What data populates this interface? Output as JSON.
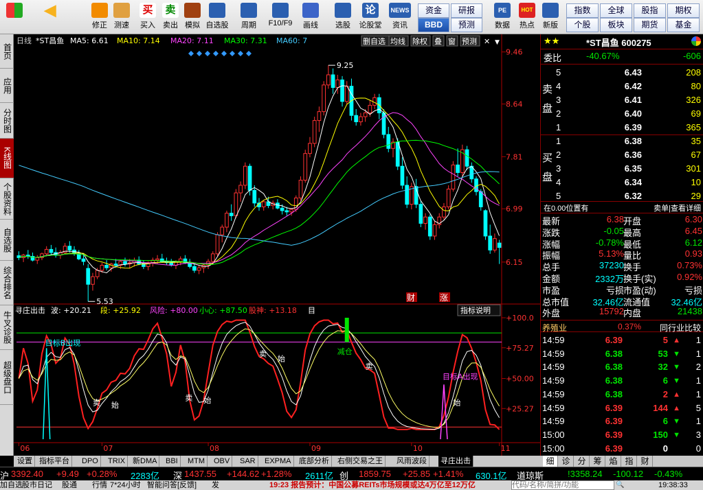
{
  "toolbar": {
    "buttons": [
      {
        "label": "",
        "icon": "grid-icon"
      },
      {
        "label": "",
        "icon": "back-arrow-icon"
      },
      {
        "label": "修正",
        "icon": "pinwheel-icon"
      },
      {
        "label": "测速",
        "icon": "clock-icon"
      },
      {
        "label": "买入",
        "icon": "buy-icon"
      },
      {
        "label": "卖出",
        "icon": "sell-icon"
      },
      {
        "label": "模拟",
        "icon": "hammer-icon"
      },
      {
        "label": "自选股",
        "icon": "star-folder-icon"
      },
      {
        "label": "周期",
        "icon": "cycle-icon"
      },
      {
        "label": "F10/F9",
        "icon": "f10-icon"
      },
      {
        "label": "画线",
        "icon": "pen-icon"
      },
      {
        "label": "选股",
        "icon": "select-stock-icon"
      },
      {
        "label": "论股堂",
        "icon": "forum-icon"
      },
      {
        "label": "资讯",
        "icon": "news-icon"
      },
      {
        "label": "数据",
        "icon": "data-icon"
      },
      {
        "label": "热点",
        "icon": "hot-icon"
      },
      {
        "label": "新版",
        "icon": "new-version-icon"
      }
    ],
    "forum_glyph": "论",
    "news_glyph": "NEWS",
    "pe_glyph": "PE",
    "hot_glyph": "HOT",
    "buy_glyph": "买",
    "sell_glyph": "卖",
    "top_links": [
      "资金",
      "研报",
      "BBD",
      "预测"
    ],
    "index_links": [
      "指数",
      "全球",
      "股指",
      "期权",
      "个股",
      "板块",
      "期货",
      "基金"
    ]
  },
  "leftnav": [
    "首页",
    "应用",
    "分时图",
    "K线图",
    "个股资料",
    "自选股",
    "综合排名",
    "牛叉诊股",
    "超级盘口"
  ],
  "chart": {
    "legend": {
      "period": "日线",
      "name": "*ST昌鱼",
      "ma5": "MA5: 6.61",
      "ma10": "MA10: 7.14",
      "ma20": "MA20: 7.11",
      "ma30": "MA30: 7.31",
      "ma60": "MA60: 7"
    },
    "tools": [
      "删自选",
      "均线",
      "除权",
      "叠",
      "窗",
      "预测"
    ],
    "price_labels": [
      "9.46",
      "8.64",
      "7.81",
      "6.99",
      "6.15"
    ],
    "high_label": "9.25",
    "low_label": "5.53",
    "marker_cai": "财",
    "marker_zhang": "涨",
    "month_labels": [
      "06",
      "07",
      "08",
      "09",
      "10",
      "11"
    ],
    "indicator": {
      "name": "寻庄出击",
      "bo": "波: +20.21",
      "duan": "段: +25.92",
      "risk": "风险: +80.00",
      "care": "小心: +87.50",
      "god": "股神: +13.18",
      "tail": "目",
      "help": "指标说明",
      "levels": [
        "+100.0",
        "+75.27",
        "+50.00",
        "+25.27"
      ],
      "target_b": "目标B出现",
      "target_a": "目标A出现",
      "reduce": "减仓",
      "signals": [
        "卖",
        "始",
        "卖",
        "始",
        "卖",
        "始",
        "卖",
        "始"
      ]
    }
  },
  "chart_data": {
    "type": "candlestick",
    "title": "*ST昌鱼",
    "x_labels": [
      "06",
      "07",
      "08",
      "09",
      "10",
      "11"
    ],
    "ylim": [
      5.5,
      9.5
    ],
    "price_ticks": [
      9.46,
      8.64,
      7.81,
      6.99,
      6.15
    ],
    "indicator_ticks": [
      100.0,
      75.27,
      50.0,
      25.27
    ],
    "candles": [
      [
        6.25,
        6.32,
        6.18,
        6.22
      ],
      [
        6.22,
        6.28,
        6.15,
        6.26
      ],
      [
        6.26,
        6.34,
        6.2,
        6.24
      ],
      [
        6.24,
        6.3,
        6.16,
        6.18
      ],
      [
        6.18,
        6.26,
        6.12,
        6.22
      ],
      [
        6.22,
        6.3,
        6.18,
        6.28
      ],
      [
        6.28,
        6.4,
        6.24,
        6.35
      ],
      [
        6.35,
        6.42,
        6.26,
        6.3
      ],
      [
        6.3,
        6.38,
        6.22,
        6.26
      ],
      [
        6.26,
        6.34,
        6.2,
        6.3
      ],
      [
        6.3,
        6.45,
        6.28,
        6.4
      ],
      [
        6.4,
        6.48,
        6.3,
        6.34
      ],
      [
        6.34,
        6.4,
        6.25,
        6.28
      ],
      [
        6.28,
        6.34,
        6.18,
        6.2
      ],
      [
        6.2,
        6.26,
        6.1,
        6.16
      ],
      [
        6.05,
        6.12,
        5.53,
        5.8
      ],
      [
        5.8,
        5.98,
        5.7,
        5.92
      ],
      [
        5.92,
        6.06,
        5.88,
        6.02
      ],
      [
        6.02,
        6.14,
        5.98,
        6.1
      ],
      [
        6.1,
        6.18,
        6.02,
        6.06
      ],
      [
        6.06,
        6.14,
        6.0,
        6.12
      ],
      [
        6.12,
        6.2,
        6.06,
        6.1
      ],
      [
        6.1,
        6.18,
        6.04,
        6.16
      ],
      [
        6.16,
        6.22,
        6.08,
        6.12
      ],
      [
        6.12,
        6.2,
        6.05,
        6.14
      ],
      [
        6.14,
        6.22,
        6.08,
        6.18
      ],
      [
        6.18,
        6.24,
        6.1,
        6.12
      ],
      [
        6.12,
        6.18,
        6.04,
        6.08
      ],
      [
        6.08,
        6.16,
        6.02,
        6.14
      ],
      [
        6.14,
        6.22,
        6.08,
        6.18
      ],
      [
        6.18,
        6.26,
        6.12,
        6.2
      ],
      [
        6.2,
        6.28,
        6.14,
        6.16
      ],
      [
        6.16,
        6.22,
        6.1,
        6.14
      ],
      [
        6.14,
        6.2,
        6.08,
        6.1
      ],
      [
        6.1,
        6.18,
        6.04,
        6.16
      ],
      [
        6.16,
        6.24,
        6.1,
        6.2
      ],
      [
        6.2,
        6.26,
        6.12,
        6.14
      ],
      [
        6.14,
        6.2,
        6.05,
        6.08
      ],
      [
        6.08,
        6.14,
        5.98,
        6.02
      ],
      [
        6.02,
        6.1,
        5.96,
        6.06
      ],
      [
        6.06,
        6.12,
        5.98,
        6.1
      ],
      [
        6.1,
        6.2,
        6.04,
        6.16
      ],
      [
        6.16,
        6.32,
        6.12,
        6.28
      ],
      [
        6.28,
        6.62,
        6.24,
        6.58
      ],
      [
        6.58,
        6.74,
        6.46,
        6.7
      ],
      [
        6.7,
        6.96,
        6.62,
        6.92
      ],
      [
        6.92,
        7.06,
        6.8,
        6.88
      ],
      [
        6.88,
        7.3,
        6.84,
        7.24
      ],
      [
        7.24,
        7.42,
        7.1,
        7.36
      ],
      [
        7.36,
        7.72,
        7.3,
        7.66
      ],
      [
        7.66,
        7.7,
        7.2,
        7.28
      ],
      [
        7.28,
        7.36,
        7.02,
        7.08
      ],
      [
        7.08,
        7.16,
        6.96,
        7.02
      ],
      [
        7.02,
        7.12,
        6.96,
        7.1
      ],
      [
        7.1,
        7.18,
        7.0,
        7.04
      ],
      [
        7.04,
        7.12,
        6.98,
        7.08
      ],
      [
        7.08,
        7.14,
        6.98,
        7.0
      ],
      [
        7.0,
        7.06,
        6.9,
        6.96
      ],
      [
        6.96,
        7.02,
        6.88,
        6.94
      ],
      [
        6.94,
        7.0,
        6.88,
        6.98
      ],
      [
        6.98,
        7.2,
        6.94,
        7.16
      ],
      [
        7.16,
        7.5,
        7.12,
        7.44
      ],
      [
        7.44,
        7.92,
        7.4,
        7.86
      ],
      [
        7.86,
        8.12,
        7.8,
        8.02
      ],
      [
        8.02,
        8.44,
        7.96,
        8.38
      ],
      [
        8.38,
        8.6,
        8.2,
        8.52
      ],
      [
        8.52,
        9.0,
        8.46,
        8.94
      ],
      [
        8.94,
        9.25,
        8.88,
        9.1
      ],
      [
        9.1,
        9.2,
        8.8,
        8.9
      ],
      [
        8.9,
        9.1,
        8.8,
        9.02
      ],
      [
        9.02,
        9.08,
        8.6,
        8.68
      ],
      [
        8.68,
        9.0,
        8.64,
        8.92
      ],
      [
        8.92,
        9.04,
        8.38,
        8.46
      ],
      [
        8.46,
        8.56,
        8.3,
        8.36
      ],
      [
        8.36,
        8.5,
        8.3,
        8.44
      ],
      [
        8.44,
        8.56,
        8.36,
        8.5
      ],
      [
        8.5,
        8.7,
        8.44,
        8.62
      ],
      [
        8.62,
        8.8,
        8.56,
        8.74
      ],
      [
        8.74,
        8.8,
        8.4,
        8.5
      ],
      [
        8.5,
        8.56,
        8.1,
        8.16
      ],
      [
        8.16,
        8.28,
        7.88,
        7.94
      ],
      [
        7.94,
        8.1,
        7.8,
        8.04
      ],
      [
        8.04,
        8.1,
        7.6,
        7.66
      ],
      [
        7.66,
        7.8,
        7.3,
        7.36
      ],
      [
        7.36,
        7.5,
        7.0,
        7.06
      ],
      [
        7.06,
        7.4,
        6.98,
        7.34
      ],
      [
        7.34,
        7.46,
        7.0,
        7.06
      ],
      [
        7.06,
        7.12,
        6.7,
        6.76
      ],
      [
        6.76,
        6.92,
        6.66,
        6.86
      ],
      [
        6.86,
        6.9,
        6.5,
        6.56
      ],
      [
        6.56,
        6.8,
        6.5,
        6.74
      ],
      [
        6.74,
        6.92,
        6.68,
        6.86
      ],
      [
        6.86,
        7.08,
        6.82,
        7.02
      ],
      [
        7.02,
        7.36,
        6.98,
        7.3
      ],
      [
        7.3,
        7.74,
        7.26,
        7.68
      ],
      [
        7.68,
        7.94,
        7.5,
        7.56
      ],
      [
        7.56,
        8.0,
        7.5,
        7.92
      ],
      [
        7.92,
        7.98,
        7.6,
        7.66
      ],
      [
        7.66,
        7.72,
        7.4,
        7.46
      ],
      [
        7.46,
        7.5,
        7.2,
        7.26
      ],
      [
        7.26,
        7.3,
        6.96,
        7.02
      ],
      [
        6.96,
        6.98,
        6.5,
        6.56
      ],
      [
        6.56,
        6.74,
        6.28,
        6.34
      ],
      [
        6.34,
        6.6,
        6.3,
        6.52
      ],
      [
        6.45,
        6.5,
        6.12,
        6.38
      ]
    ]
  },
  "panel": {
    "stars": "★★",
    "title": "*ST昌鱼 600275",
    "wei_label": "委比",
    "wei_pct": "-40.67%",
    "wei_diff": "-606",
    "sell_side": "卖盘",
    "buy_side": "买盘",
    "asks": [
      [
        "5",
        "6.43",
        "208"
      ],
      [
        "4",
        "6.42",
        "80"
      ],
      [
        "3",
        "6.41",
        "326"
      ],
      [
        "2",
        "6.40",
        "69"
      ],
      [
        "1",
        "6.39",
        "365"
      ]
    ],
    "bids": [
      [
        "1",
        "6.38",
        "35"
      ],
      [
        "2",
        "6.36",
        "67"
      ],
      [
        "3",
        "6.35",
        "301"
      ],
      [
        "4",
        "6.34",
        "10"
      ],
      [
        "5",
        "6.32",
        "29"
      ]
    ],
    "pos": "在0.00位置有",
    "pos_right": "卖单|查看详细",
    "stats": [
      [
        "最新",
        "6.38",
        "开盘",
        "6.30"
      ],
      [
        "涨跌",
        "-0.05",
        "最高",
        "6.45"
      ],
      [
        "涨幅",
        "-0.78%",
        "最低",
        "6.12"
      ],
      [
        "振幅",
        "5.13%",
        "量比",
        "0.93"
      ],
      [
        "总手",
        "37230",
        "换手",
        "0.73%"
      ],
      [
        "金额",
        "2332万",
        "换手(实)",
        "0.92%"
      ],
      [
        "市盈",
        "亏损",
        "市盈(动)",
        "亏损"
      ],
      [
        "总市值",
        "32.46亿",
        "流通值",
        "32.46亿"
      ],
      [
        "外盘",
        "15792",
        "内盘",
        "21438"
      ]
    ],
    "industry": "养殖业",
    "industry_pct": "0.37%",
    "industry_cmp": "同行业比较",
    "ticks": [
      [
        "14:59",
        "6.39",
        "5",
        "up",
        "1"
      ],
      [
        "14:59",
        "6.38",
        "53",
        "down",
        "1"
      ],
      [
        "14:59",
        "6.38",
        "32",
        "down",
        "2"
      ],
      [
        "14:59",
        "6.38",
        "6",
        "down",
        "1"
      ],
      [
        "14:59",
        "6.38",
        "2",
        "up",
        "1"
      ],
      [
        "14:59",
        "6.39",
        "144",
        "up",
        "5"
      ],
      [
        "14:59",
        "6.39",
        "6",
        "down",
        "1"
      ],
      [
        "15:00",
        "6.39",
        "150",
        "down",
        "3"
      ],
      [
        "15:00",
        "6.39",
        "0",
        "",
        "0"
      ]
    ],
    "tabs": [
      "细",
      "诊",
      "分",
      "筹",
      "焰",
      "指",
      "财"
    ]
  },
  "bottom_tabs": [
    "设置",
    "指标平台",
    "DPO",
    "TRIX",
    "新DMA",
    "BBI",
    "MTM",
    "OBV",
    "SAR",
    "EXPMA",
    "底部分析",
    "右侧交易之王",
    "风雨波段",
    "寻庄出击"
  ],
  "index_bar": {
    "sh_label": "沪",
    "sh_val": "3392.40",
    "sh_chg": "+9.49",
    "sh_pct": "+0.28%",
    "sh_amt": "2283亿",
    "sz_label": "深",
    "sz_val": "1437.55",
    "sz_chg": "+144.62",
    "sz_pct": "+1.28%",
    "sz_amt": "2611亿",
    "cy_label": "创",
    "cy_val": "1859.75",
    "cy_chg": "+25.85",
    "cy_pct": "+1.41%",
    "cy_amt": "630.1亿",
    "dj_label": "道琼斯",
    "dj_val": "!3358.24",
    "dj_chg": "-100.12",
    "dj_pct": "-0.43%"
  },
  "status_bar": {
    "items": [
      "加自选",
      "股市日记",
      "股通",
      "行情",
      "7*24小时",
      "智能问答[反馈]",
      "发"
    ],
    "ticker": "19:23 报告预计：中国公募REITs市场规模或达4万亿至12万亿",
    "search_ph": "代码/名称/简拼/功能",
    "time": "19:38:33"
  }
}
